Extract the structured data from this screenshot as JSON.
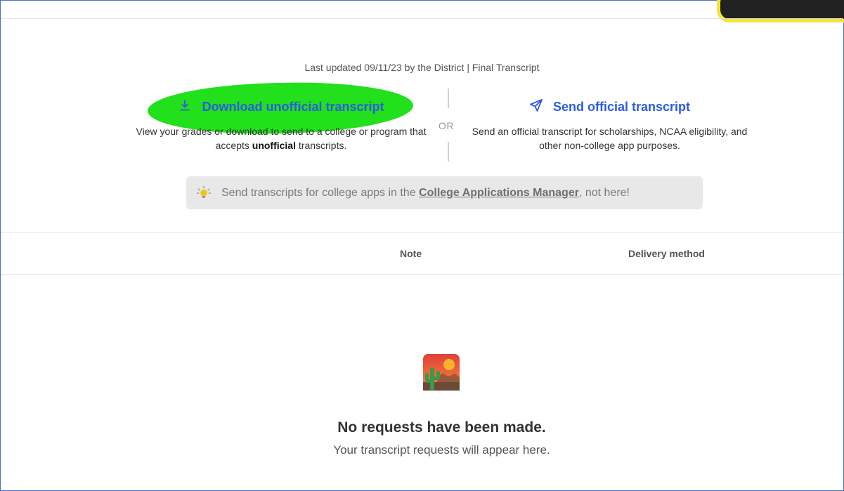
{
  "header": {
    "last_updated": "Last updated 09/11/23 by the District | Final Transcript"
  },
  "download": {
    "label": "Download unofficial transcript",
    "icon": "download-icon",
    "desc_prefix": "View your grades or download to send to a college or program that accepts ",
    "desc_bold": "unofficial",
    "desc_suffix": " transcripts."
  },
  "divider": {
    "or_label": "OR"
  },
  "send": {
    "label": "Send official transcript",
    "icon": "paper-plane-icon",
    "desc": "Send an official transcript for scholarships, NCAA eligibility, and other non-college app purposes."
  },
  "notice": {
    "icon": "lightbulb-icon",
    "text_prefix": "Send transcripts for college apps in the ",
    "link_text": "College Applications Manager",
    "text_suffix": ", not here!"
  },
  "table": {
    "columns": [
      "Note",
      "Delivery method"
    ]
  },
  "empty_state": {
    "icon": "desert-cactus-icon",
    "title": "No requests have been made.",
    "subtitle": "Your transcript requests will appear here."
  },
  "colors": {
    "link": "#2d5be3",
    "highlight": "#22e01b",
    "notice_bg": "#e8e8e8"
  }
}
